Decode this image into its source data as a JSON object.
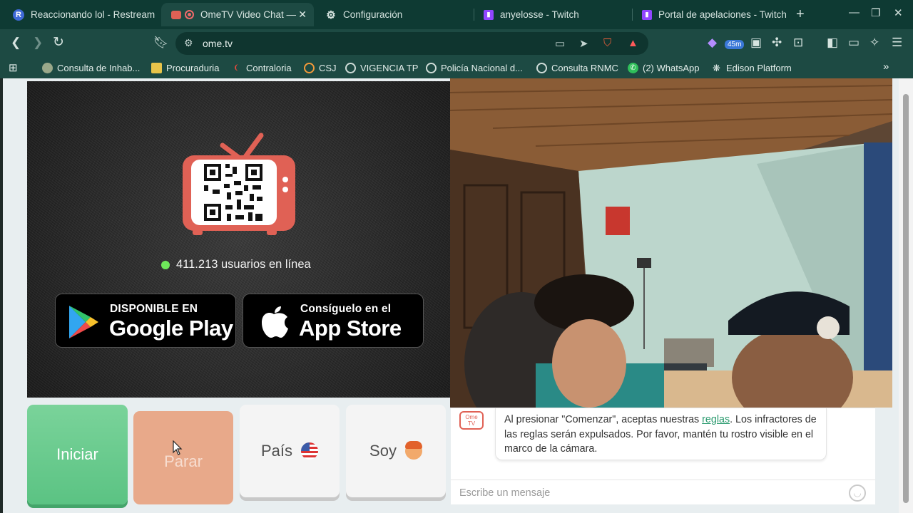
{
  "browser": {
    "tabs": [
      {
        "title": "Reaccionando lol - Restream",
        "icon": "restream-icon",
        "active": false
      },
      {
        "title": "OmeTV Video Chat —",
        "icon": "ometv-icon",
        "active": true,
        "close": "✕"
      },
      {
        "title": "Configuración",
        "icon": "gear-icon",
        "active": false
      },
      {
        "title": "anyelosse - Twitch",
        "icon": "twitch-icon",
        "active": false
      },
      {
        "title": "Portal de apelaciones - Twitch",
        "icon": "twitch-icon",
        "active": false
      }
    ],
    "new_tab": "+",
    "window_controls": {
      "minimize": "—",
      "restore": "❐",
      "close": "✕"
    },
    "url": "ome.tv",
    "extension_badge": "45m",
    "bookmarks": [
      {
        "label": "Consulta de Inhab...",
        "icon": "shield-icon"
      },
      {
        "label": "Procuraduria",
        "icon": "procuraduria-icon"
      },
      {
        "label": "Contraloria",
        "icon": "contraloria-icon"
      },
      {
        "label": "CSJ",
        "icon": "csj-icon"
      },
      {
        "label": "VIGENCIA TP",
        "icon": "globe-icon"
      },
      {
        "label": "Policía Nacional d...",
        "icon": "globe-icon"
      },
      {
        "label": "Consulta RNMC",
        "icon": "globe-icon"
      },
      {
        "label": "(2) WhatsApp",
        "icon": "whatsapp-icon"
      },
      {
        "label": "Edison Platform",
        "icon": "edison-icon"
      }
    ],
    "bookmarks_more": "»"
  },
  "app": {
    "online_count": "411.213 usuarios en línea",
    "google_play": {
      "small": "DISPONIBLE EN",
      "big": "Google Play"
    },
    "app_store": {
      "small": "Consíguelo en el",
      "big": "App Store"
    },
    "buttons": {
      "start": "Iniciar",
      "stop": "Parar",
      "country": "País",
      "gender": "Soy"
    },
    "chat": {
      "logo_line1": "Ome",
      "logo_line2": "TV",
      "notice_before": "Al presionar \"Comenzar\", aceptas nuestras ",
      "notice_link": "reglas",
      "notice_after": ". Los infractores de las reglas serán expulsados. Por favor, mantén tu rostro visible en el marco de la cámara.",
      "input_placeholder": "Escribe un mensaje"
    }
  },
  "colors": {
    "start": "#6ccb8f",
    "stop": "#e8a98a",
    "online_dot": "#6ee85a",
    "accent_link": "#2a9a6e",
    "browser_frame": "#0e3a33"
  }
}
